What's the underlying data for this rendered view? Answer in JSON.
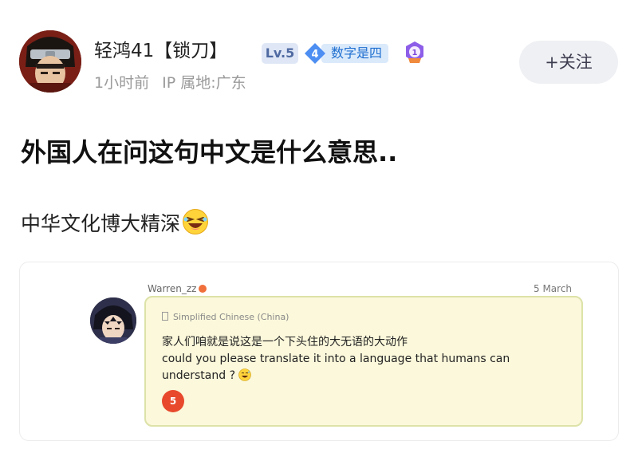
{
  "user": {
    "name": "轻鸿41【锁刀】",
    "level": "Lv.5",
    "fan_level": "4",
    "fan_label": "数字是四",
    "medal_number": "1",
    "time_ago": "1小时前",
    "ip_location": "IP 属地:广东"
  },
  "actions": {
    "follow_label": "+关注"
  },
  "post": {
    "title": "外国人在问这句中文是什么意思..",
    "body": "中华文化博大精深"
  },
  "embedded_screenshot": {
    "username": "Warren_zz",
    "date": "5 March",
    "language": "Simplified Chinese (China)",
    "message_cn": "家人们咱就是说这是一个下头住的大无语的大动作",
    "message_en": "could you please translate it into a language that humans can understand ?",
    "count": "5"
  },
  "colors": {
    "level_badge": "#dfe7f6",
    "fan_badge": "#dbeafb",
    "follow_button": "#eff0f4",
    "bubble_background": "#fbf8db",
    "count_badge": "#e8492c"
  },
  "icons": {
    "fan_badge": "diamond-icon",
    "medal": "medal-icon",
    "body_emoji": "laughing-emoji-icon",
    "message_emoji": "sweat-smile-emoji-icon"
  }
}
